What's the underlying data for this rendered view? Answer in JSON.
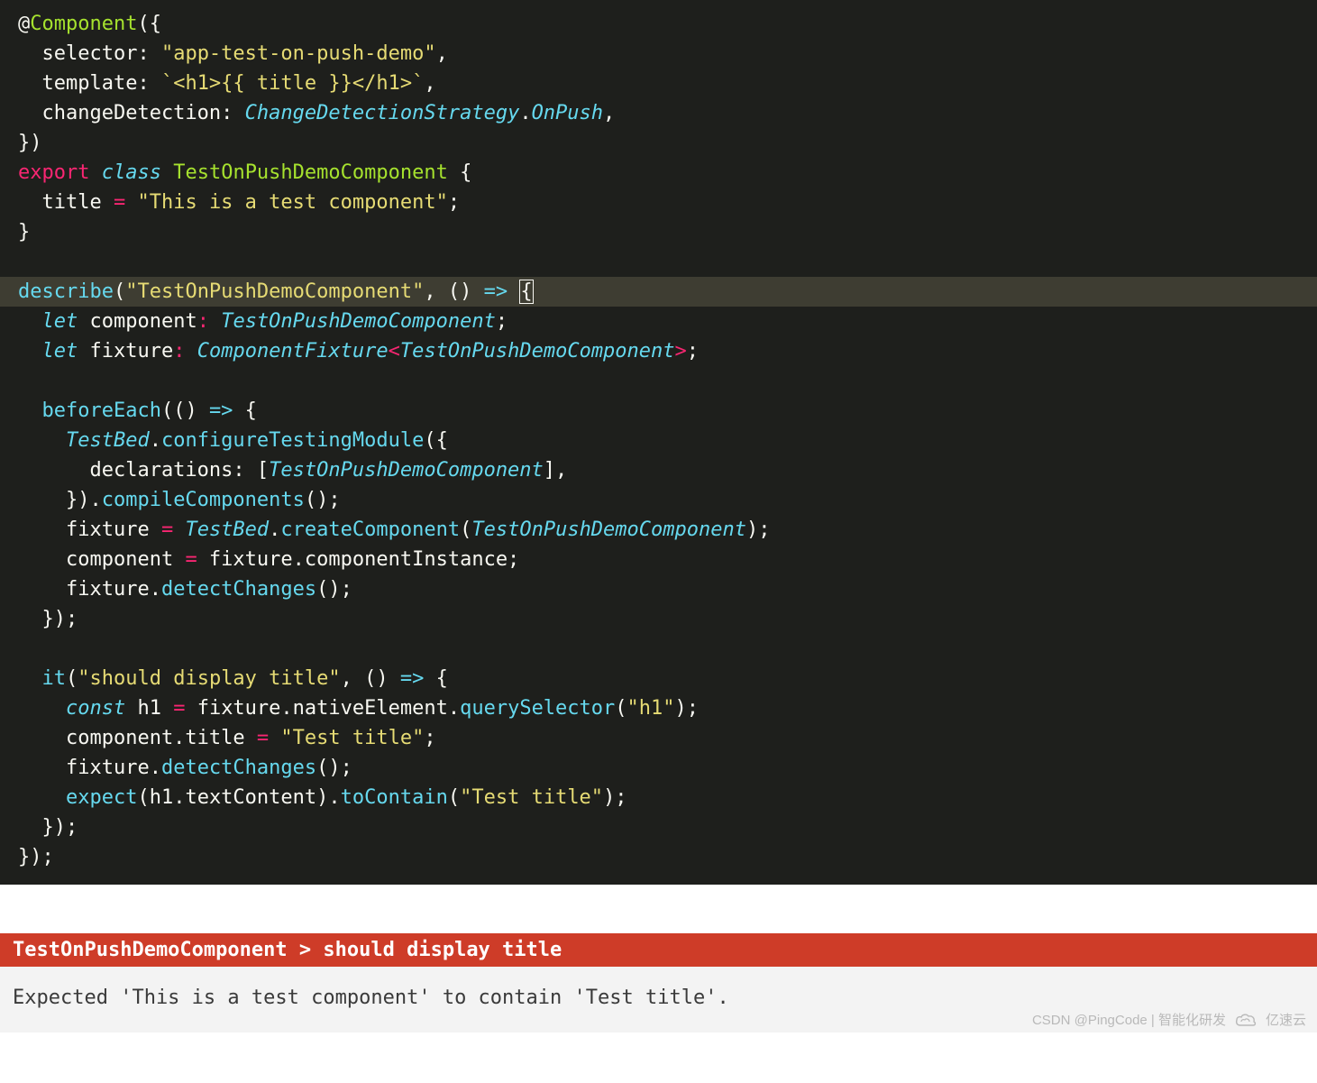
{
  "code": {
    "lines": [
      [
        {
          "t": "@",
          "c": "t-default"
        },
        {
          "t": "Component",
          "c": "t-decor"
        },
        {
          "t": "({",
          "c": "t-default"
        }
      ],
      [
        {
          "t": "  selector: ",
          "c": "t-default"
        },
        {
          "t": "\"app-test-on-push-demo\"",
          "c": "t-string"
        },
        {
          "t": ",",
          "c": "t-default"
        }
      ],
      [
        {
          "t": "  template: ",
          "c": "t-default"
        },
        {
          "t": "`<h1>{{ title }}</h1>`",
          "c": "t-string"
        },
        {
          "t": ",",
          "c": "t-default"
        }
      ],
      [
        {
          "t": "  changeDetection: ",
          "c": "t-default"
        },
        {
          "t": "ChangeDetectionStrategy",
          "c": "t-type"
        },
        {
          "t": ".",
          "c": "t-default"
        },
        {
          "t": "OnPush",
          "c": "t-type"
        },
        {
          "t": ",",
          "c": "t-default"
        }
      ],
      [
        {
          "t": "})",
          "c": "t-default"
        }
      ],
      [
        {
          "t": "export",
          "c": "t-keyword"
        },
        {
          "t": " ",
          "c": "t-default"
        },
        {
          "t": "class",
          "c": "t-type"
        },
        {
          "t": " ",
          "c": "t-default"
        },
        {
          "t": "TestOnPushDemoComponent",
          "c": "t-class"
        },
        {
          "t": " {",
          "c": "t-default"
        }
      ],
      [
        {
          "t": "  title ",
          "c": "t-default"
        },
        {
          "t": "=",
          "c": "t-keyword"
        },
        {
          "t": " ",
          "c": "t-default"
        },
        {
          "t": "\"This is a test component\"",
          "c": "t-string"
        },
        {
          "t": ";",
          "c": "t-default"
        }
      ],
      [
        {
          "t": "}",
          "c": "t-default"
        }
      ],
      [
        {
          "t": " ",
          "c": "t-default"
        }
      ],
      [
        {
          "t": "describe",
          "c": "t-func"
        },
        {
          "t": "(",
          "c": "t-default"
        },
        {
          "t": "\"TestOnPushDemoComponent\"",
          "c": "t-string"
        },
        {
          "t": ", () ",
          "c": "t-default"
        },
        {
          "t": "=>",
          "c": "t-type"
        },
        {
          "t": " ",
          "c": "t-default"
        },
        {
          "t": "{",
          "c": "t-default",
          "cursor": true
        }
      ],
      [
        {
          "t": "  ",
          "c": "t-default"
        },
        {
          "t": "let",
          "c": "t-type"
        },
        {
          "t": " component",
          "c": "t-default"
        },
        {
          "t": ": ",
          "c": "t-keyword"
        },
        {
          "t": "TestOnPushDemoComponent",
          "c": "t-type"
        },
        {
          "t": ";",
          "c": "t-default"
        }
      ],
      [
        {
          "t": "  ",
          "c": "t-default"
        },
        {
          "t": "let",
          "c": "t-type"
        },
        {
          "t": " fixture",
          "c": "t-default"
        },
        {
          "t": ": ",
          "c": "t-keyword"
        },
        {
          "t": "ComponentFixture",
          "c": "t-type"
        },
        {
          "t": "<",
          "c": "t-keyword"
        },
        {
          "t": "TestOnPushDemoComponent",
          "c": "t-type"
        },
        {
          "t": ">",
          "c": "t-keyword"
        },
        {
          "t": ";",
          "c": "t-default"
        }
      ],
      [
        {
          "t": " ",
          "c": "t-default"
        }
      ],
      [
        {
          "t": "  ",
          "c": "t-default"
        },
        {
          "t": "beforeEach",
          "c": "t-func"
        },
        {
          "t": "(() ",
          "c": "t-default"
        },
        {
          "t": "=>",
          "c": "t-type"
        },
        {
          "t": " {",
          "c": "t-default"
        }
      ],
      [
        {
          "t": "    ",
          "c": "t-default"
        },
        {
          "t": "TestBed",
          "c": "t-type"
        },
        {
          "t": ".",
          "c": "t-default"
        },
        {
          "t": "configureTestingModule",
          "c": "t-func"
        },
        {
          "t": "({",
          "c": "t-default"
        }
      ],
      [
        {
          "t": "      declarations: [",
          "c": "t-default"
        },
        {
          "t": "TestOnPushDemoComponent",
          "c": "t-type"
        },
        {
          "t": "],",
          "c": "t-default"
        }
      ],
      [
        {
          "t": "    }).",
          "c": "t-default"
        },
        {
          "t": "compileComponents",
          "c": "t-func"
        },
        {
          "t": "();",
          "c": "t-default"
        }
      ],
      [
        {
          "t": "    fixture ",
          "c": "t-default"
        },
        {
          "t": "=",
          "c": "t-keyword"
        },
        {
          "t": " ",
          "c": "t-default"
        },
        {
          "t": "TestBed",
          "c": "t-type"
        },
        {
          "t": ".",
          "c": "t-default"
        },
        {
          "t": "createComponent",
          "c": "t-func"
        },
        {
          "t": "(",
          "c": "t-default"
        },
        {
          "t": "TestOnPushDemoComponent",
          "c": "t-type"
        },
        {
          "t": ");",
          "c": "t-default"
        }
      ],
      [
        {
          "t": "    component ",
          "c": "t-default"
        },
        {
          "t": "=",
          "c": "t-keyword"
        },
        {
          "t": " fixture.componentInstance;",
          "c": "t-default"
        }
      ],
      [
        {
          "t": "    fixture.",
          "c": "t-default"
        },
        {
          "t": "detectChanges",
          "c": "t-func"
        },
        {
          "t": "();",
          "c": "t-default"
        }
      ],
      [
        {
          "t": "  });",
          "c": "t-default"
        }
      ],
      [
        {
          "t": " ",
          "c": "t-default"
        }
      ],
      [
        {
          "t": "  ",
          "c": "t-default"
        },
        {
          "t": "it",
          "c": "t-func"
        },
        {
          "t": "(",
          "c": "t-default"
        },
        {
          "t": "\"should display title\"",
          "c": "t-string"
        },
        {
          "t": ", () ",
          "c": "t-default"
        },
        {
          "t": "=>",
          "c": "t-type"
        },
        {
          "t": " {",
          "c": "t-default"
        }
      ],
      [
        {
          "t": "    ",
          "c": "t-default"
        },
        {
          "t": "const",
          "c": "t-type"
        },
        {
          "t": " h1 ",
          "c": "t-default"
        },
        {
          "t": "=",
          "c": "t-keyword"
        },
        {
          "t": " fixture.nativeElement.",
          "c": "t-default"
        },
        {
          "t": "querySelector",
          "c": "t-func"
        },
        {
          "t": "(",
          "c": "t-default"
        },
        {
          "t": "\"h1\"",
          "c": "t-string"
        },
        {
          "t": ");",
          "c": "t-default"
        }
      ],
      [
        {
          "t": "    component.title ",
          "c": "t-default"
        },
        {
          "t": "=",
          "c": "t-keyword"
        },
        {
          "t": " ",
          "c": "t-default"
        },
        {
          "t": "\"Test title\"",
          "c": "t-string"
        },
        {
          "t": ";",
          "c": "t-default"
        }
      ],
      [
        {
          "t": "    fixture.",
          "c": "t-default"
        },
        {
          "t": "detectChanges",
          "c": "t-func"
        },
        {
          "t": "();",
          "c": "t-default"
        }
      ],
      [
        {
          "t": "    ",
          "c": "t-default"
        },
        {
          "t": "expect",
          "c": "t-func"
        },
        {
          "t": "(h1.textContent).",
          "c": "t-default"
        },
        {
          "t": "toContain",
          "c": "t-func"
        },
        {
          "t": "(",
          "c": "t-default"
        },
        {
          "t": "\"Test title\"",
          "c": "t-string"
        },
        {
          "t": ");",
          "c": "t-default"
        }
      ],
      [
        {
          "t": "  });",
          "c": "t-default"
        }
      ],
      [
        {
          "t": "});",
          "c": "t-default"
        }
      ]
    ],
    "highlight_index": 9
  },
  "report": {
    "header": "TestOnPushDemoComponent > should display title",
    "message": "Expected 'This is a test component' to contain 'Test title'."
  },
  "watermark": {
    "left": "CSDN @PingCode | 智能化研发",
    "right": "亿速云"
  }
}
